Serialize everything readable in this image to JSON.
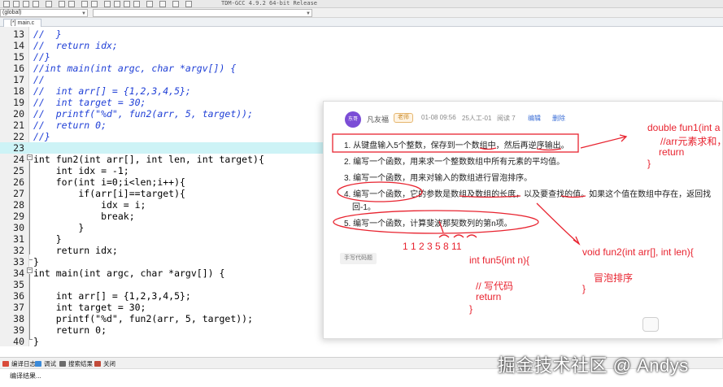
{
  "toolbar": {
    "version_label": "TDM-GCC 4.9.2 64-bit Release"
  },
  "row2": {
    "combo1": "(global)",
    "combo2": ""
  },
  "editor": {
    "tab_label": "[*] main.c",
    "lines": [
      {
        "n": "13",
        "text": "//  }",
        "type": "comment"
      },
      {
        "n": "14",
        "text": "//  return idx;",
        "type": "comment"
      },
      {
        "n": "15",
        "text": "//}",
        "type": "comment"
      },
      {
        "n": "16",
        "text": "//int main(int argc, char *argv[]) {",
        "type": "comment"
      },
      {
        "n": "17",
        "text": "//",
        "type": "comment"
      },
      {
        "n": "18",
        "text": "//  int arr[] = {1,2,3,4,5};",
        "type": "comment"
      },
      {
        "n": "19",
        "text": "//  int target = 30;",
        "type": "comment"
      },
      {
        "n": "20",
        "text": "//  printf(\"%d\", fun2(arr, 5, target));",
        "type": "comment"
      },
      {
        "n": "21",
        "text": "//  return 0;",
        "type": "comment"
      },
      {
        "n": "22",
        "text": "//}",
        "type": "comment"
      },
      {
        "n": "23",
        "text": "",
        "type": "current"
      },
      {
        "n": "24",
        "text": "int fun2(int arr[], int len, int target){",
        "type": "code"
      },
      {
        "n": "25",
        "text": "    int idx = -1;",
        "type": "code"
      },
      {
        "n": "26",
        "text": "    for(int i=0;i<len;i++){",
        "type": "code"
      },
      {
        "n": "27",
        "text": "        if(arr[i]==target){",
        "type": "code"
      },
      {
        "n": "28",
        "text": "            idx = i;",
        "type": "code"
      },
      {
        "n": "29",
        "text": "            break;",
        "type": "code"
      },
      {
        "n": "30",
        "text": "        }",
        "type": "code"
      },
      {
        "n": "31",
        "text": "    }",
        "type": "code"
      },
      {
        "n": "32",
        "text": "    return idx;",
        "type": "code"
      },
      {
        "n": "33",
        "text": "}",
        "type": "code"
      },
      {
        "n": "34",
        "text": "int main(int argc, char *argv[]) {",
        "type": "code"
      },
      {
        "n": "35",
        "text": "",
        "type": "code"
      },
      {
        "n": "36",
        "text": "    int arr[] = {1,2,3,4,5};",
        "type": "code"
      },
      {
        "n": "37",
        "text": "    int target = 30;",
        "type": "code"
      },
      {
        "n": "38",
        "text": "    printf(\"%d\", fun2(arr, 5, target));",
        "type": "code"
      },
      {
        "n": "39",
        "text": "    return 0;",
        "type": "code"
      },
      {
        "n": "40",
        "text": "}",
        "type": "code"
      }
    ]
  },
  "bottom_tabs": [
    {
      "label": "编译日志",
      "color": "#d94b3a"
    },
    {
      "label": "调试",
      "color": "#3a8ad9"
    },
    {
      "label": "搜索结果",
      "color": "#6b6b6b"
    },
    {
      "label": "关闭",
      "color": "#c24b3a"
    }
  ],
  "status": {
    "text": "编译结果..."
  },
  "card": {
    "avatar_text": "东哥",
    "author": "凡友福",
    "role": "老师",
    "datetime": "01-08 09:56",
    "group": "25人工-01",
    "reads": "阅读 7",
    "edit": "编辑",
    "delete": "删除",
    "items": [
      "1. 从键盘输入5个整数，保存到一个数组中，然后再逆序输出。",
      "2. 编写一个函数，用来求一个整数数组中所有元素的平均值。",
      "3. 编写一个函数，用来对输入的数组进行冒泡排序。",
      "4. 编写一个函数，它的参数是数组及数组的长度，以及要查找的值。如果这个值在数组中存在，返回找",
      "回-1。",
      "5. 编写一个函数，计算斐波那契数列的第n项。"
    ],
    "tag": "手写代码题"
  },
  "annotations": {
    "fun1_line1": "double fun1(int a",
    "fun1_line2": "//arr元素求和，",
    "fun1_line3": "return",
    "fun1_line4": "}",
    "fib_seq": "1  1  2  3  5  8  11",
    "fun5_sig": "int fun5(int n){",
    "fun5_comment": "// 写代码",
    "fun5_return": "return",
    "fun5_close": "}",
    "fun2_sig": "void fun2(int arr[], int len){",
    "bubble": "冒泡排序",
    "fun2_close": "}"
  },
  "watermark": "掘金技术社区 @ Andys",
  "colors": {
    "annotation": "#e8232f",
    "comment": "#1f3fd6",
    "current_line": "#cdf3f6",
    "avatar": "#7b4dd6"
  }
}
